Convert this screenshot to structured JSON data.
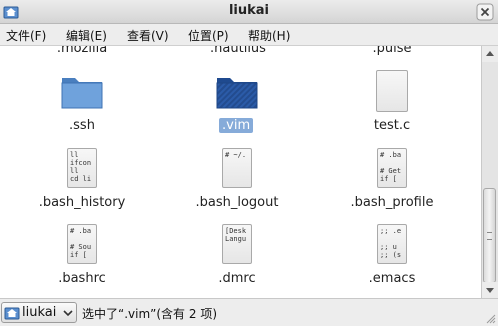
{
  "window": {
    "title": "liukai"
  },
  "menu": {
    "items": [
      {
        "label": "文件(F)"
      },
      {
        "label": "编辑(E)"
      },
      {
        "label": "查看(V)"
      },
      {
        "label": "位置(P)"
      },
      {
        "label": "帮助(H)"
      }
    ]
  },
  "files": {
    "partial_row": [
      ".mozilla",
      ".nautilus",
      ".pulse"
    ],
    "items": [
      {
        "name": ".ssh",
        "icon": "folder-icon"
      },
      {
        "name": ".vim",
        "icon": "folder-icon",
        "selected": true
      },
      {
        "name": "test.c",
        "icon": "text-file-icon"
      },
      {
        "name": ".bash_history",
        "icon": "text-file-icon",
        "preview": "ll\nifcon\nll\ncd li"
      },
      {
        "name": ".bash_logout",
        "icon": "text-file-icon",
        "preview": "# ~/."
      },
      {
        "name": ".bash_profile",
        "icon": "text-file-icon",
        "preview": "# .ba\n\n# Get\nif ["
      },
      {
        "name": ".bashrc",
        "icon": "text-file-icon",
        "preview": "# .ba\n\n# Sou\nif ["
      },
      {
        "name": ".dmrc",
        "icon": "text-file-icon",
        "preview": "[Desk\nLangu"
      },
      {
        "name": ".emacs",
        "icon": "text-file-icon",
        "preview": ";; .e\n\n;; u\n;; (s"
      }
    ]
  },
  "status": {
    "location": "liukai",
    "message": "选中了“.vim”(含有 2 项)"
  },
  "colors": {
    "selection": "#86abd9",
    "folder_blue": "#4a86c8"
  }
}
